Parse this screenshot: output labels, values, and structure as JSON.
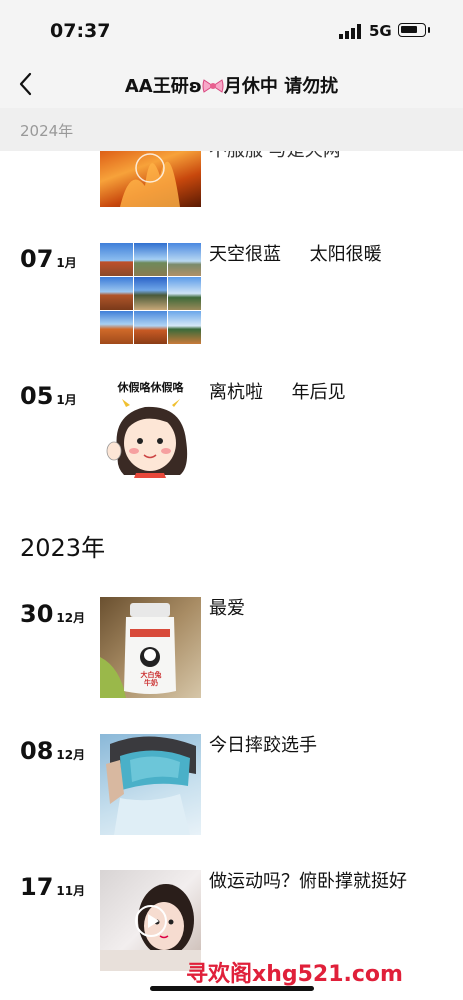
{
  "status_bar": {
    "time": "07:37",
    "network": "5G"
  },
  "nav": {
    "title_left": "AA王研ʚ",
    "title_right": "月休中  请勿扰"
  },
  "sticky_year": "2024年",
  "posts": [
    {
      "day": "",
      "month": "",
      "text": "不服服 与是天两"
    },
    {
      "day": "07",
      "month": "1月",
      "text": "天空很蓝     太阳很暖"
    },
    {
      "day": "05",
      "month": "1月",
      "text": "离杭啦     年后见",
      "sticker_text": "休假咯休假咯"
    },
    {
      "day": "30",
      "month": "12月",
      "text": "最爱",
      "bottle_text": "大白兔 牛奶"
    },
    {
      "day": "08",
      "month": "12月",
      "text": "今日摔跤选手"
    },
    {
      "day": "17",
      "month": "11月",
      "text": "做运动吗？俯卧撑就挺好"
    }
  ],
  "year_heading": "2023年",
  "watermark": "寻欢阁xhg521.com",
  "colors": {
    "bar_bg": "#f4f4f4",
    "sticky_bg": "#efefef",
    "watermark": "#e0203a"
  }
}
